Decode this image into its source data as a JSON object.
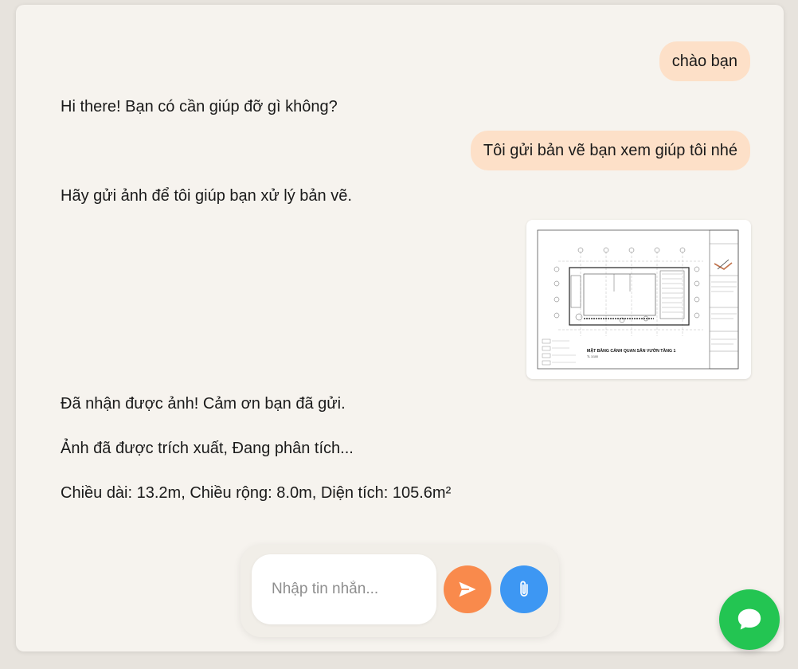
{
  "messages": {
    "user_1": "chào bạn",
    "bot_1": "Hi there! Bạn có cần giúp đỡ gì không?",
    "user_2": "Tôi gửi bản vẽ bạn xem giúp tôi nhé",
    "bot_2": "Hãy gửi ảnh để tôi giúp bạn xử lý bản vẽ.",
    "bot_3": "Đã nhận được ảnh! Cảm ơn bạn đã gửi.",
    "bot_4": "Ảnh đã được trích xuất, Đang phân tích...",
    "bot_5": "Chiều dài: 13.2m, Chiều rộng: 8.0m, Diện tích: 105.6m²"
  },
  "attachment": {
    "drawing_title": "MẶT BẰNG CẢNH QUAN SÂN VƯỜN TẦNG 1",
    "drawing_scale": "TL 1/100"
  },
  "composer": {
    "placeholder": "Nhập tin nhắn...",
    "value": ""
  },
  "icons": {
    "send": "send-icon",
    "attach": "paperclip-icon",
    "chat": "chat-bubble-icon"
  },
  "colors": {
    "user_bubble": "#fde0c8",
    "send_button": "#f98a4c",
    "attach_button": "#3d97f3",
    "chat_fab": "#23c552",
    "card_background": "#f6f3ee"
  }
}
